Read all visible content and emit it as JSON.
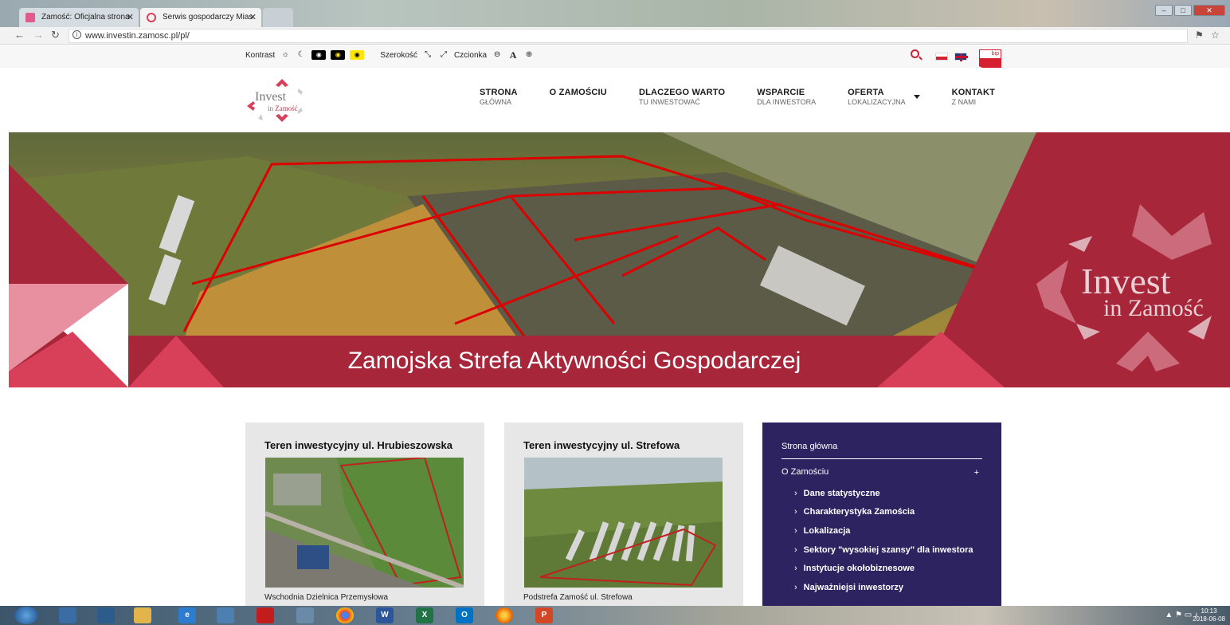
{
  "browser": {
    "tabs": [
      {
        "label": "Zamość: Oficjalna strona"
      },
      {
        "label": "Serwis gospodarczy Mias"
      }
    ],
    "url": "www.investin.zamosc.pl/pl/"
  },
  "a11y": {
    "contrast_label": "Kontrast",
    "width_label": "Szerokość",
    "font_label": "Czcionka",
    "font_letter": "A",
    "bip_label": "bip"
  },
  "logo": {
    "line1": "Invest",
    "line2_prefix": "in",
    "line2_city": "Zamość"
  },
  "nav": [
    {
      "l1": "STRONA",
      "l2": "GŁÓWNA"
    },
    {
      "l1": "O ZAMOŚCIU",
      "l2": ""
    },
    {
      "l1": "DLACZEGO WARTO",
      "l2": "TU INWESTOWAĆ"
    },
    {
      "l1": "WSPARCIE",
      "l2": "DLA INWESTORA"
    },
    {
      "l1": "OFERTA",
      "l2": "LOKALIZACYJNA"
    },
    {
      "l1": "KONTAKT",
      "l2": "Z NAMI"
    }
  ],
  "hero": {
    "title": "Zamojska Strefa Aktywności Gospodarczej",
    "logo_line1": "Invest",
    "logo_line2": "in Zamość"
  },
  "cards": [
    {
      "title": "Teren inwestycyjny ul. Hrubieszowska",
      "caption": "Wschodnia Dzielnica Przemysłowa"
    },
    {
      "title": "Teren inwestycyjny ul. Strefowa",
      "caption": "Podstrefa Zamość ul. Strefowa"
    }
  ],
  "sidemenu": {
    "home": "Strona główna",
    "section": "O Zamościu",
    "plus": "+",
    "items": [
      "Dane statystyczne",
      "Charakterystyka Zamościa",
      "Lokalizacja",
      "Sektory \"wysokiej szansy\" dla inwestora",
      "Instytucje okołobiznesowe",
      "Najważniejsi inwestorzy"
    ]
  },
  "taskbar": {
    "time": "10:13",
    "date": "2018-06-08"
  },
  "colors": {
    "brand_red": "#a7263a",
    "accent_pink": "#d8405a",
    "menu_purple": "#2d2360"
  }
}
